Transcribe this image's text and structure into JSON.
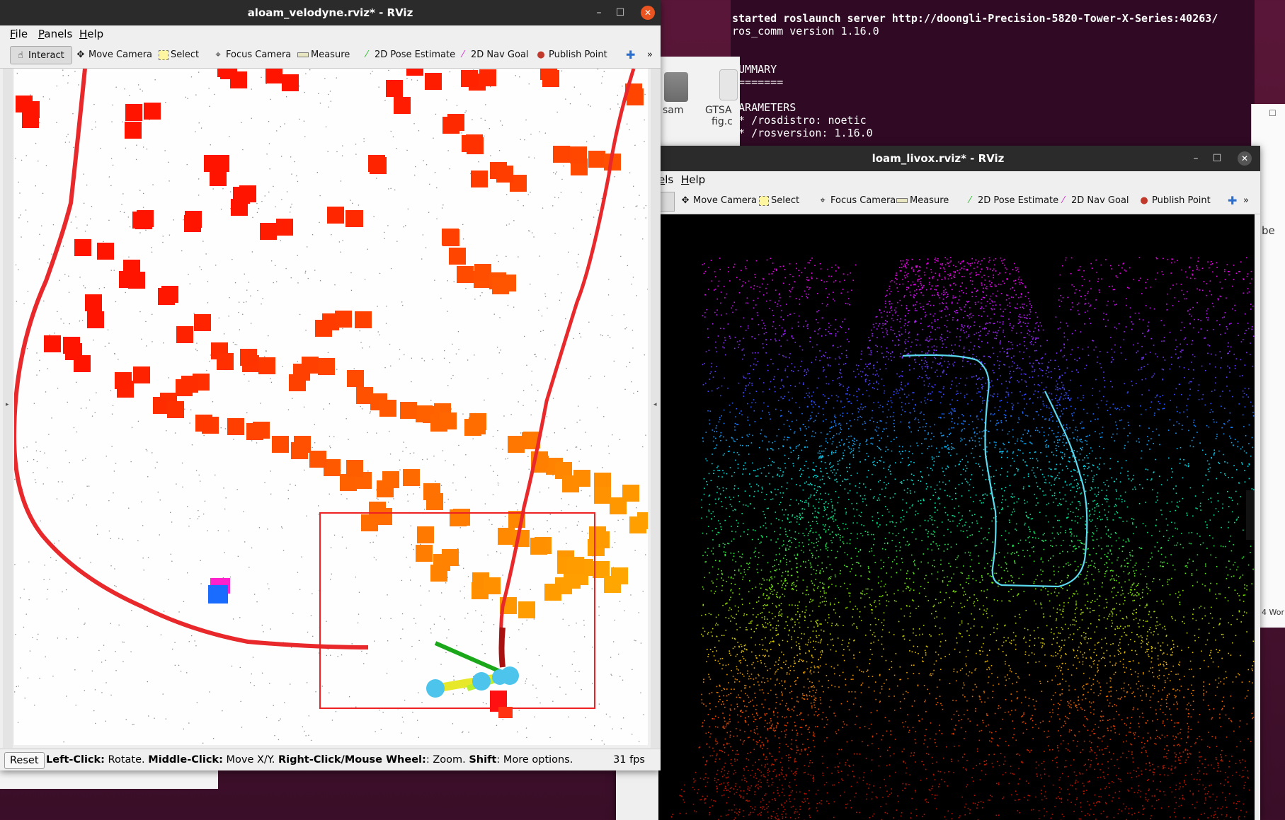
{
  "terminal": {
    "lines": [
      "started roslaunch server http://doongli-Precision-5820-Tower-X-Series:40263/",
      "ros_comm version 1.16.0",
      "",
      "",
      "SUMMARY",
      "========",
      "",
      "PARAMETERS",
      " * /rosdistro: noetic",
      " * /rosversion: 1.16.0"
    ]
  },
  "file_manager": {
    "item1_label": "sam",
    "item2_label_line1": "GTSA",
    "item2_label_line2": "fig.c"
  },
  "background_window": {
    "text1": "be",
    "text2": "4 Wor"
  },
  "left_window": {
    "title": "aloam_velodyne.rviz* - RViz",
    "menu": [
      "File",
      "Panels",
      "Help"
    ],
    "toolbar": [
      {
        "label": "Interact",
        "icon": "hand-icon"
      },
      {
        "label": "Move Camera",
        "icon": "move-camera-icon"
      },
      {
        "label": "Select",
        "icon": "select-icon"
      },
      {
        "label": "Focus Camera",
        "icon": "focus-camera-icon"
      },
      {
        "label": "Measure",
        "icon": "measure-icon"
      },
      {
        "label": "2D Pose Estimate",
        "icon": "pose-estimate-icon"
      },
      {
        "label": "2D Nav Goal",
        "icon": "nav-goal-icon"
      },
      {
        "label": "Publish Point",
        "icon": "publish-point-icon"
      }
    ],
    "active_tool": "Interact",
    "status": {
      "reset": "Reset",
      "hint_parts": [
        {
          "text": "Left-Click:",
          "bold": true
        },
        {
          "text": " Rotate. ",
          "bold": false
        },
        {
          "text": "Middle-Click:",
          "bold": true
        },
        {
          "text": " Move X/Y. ",
          "bold": false
        },
        {
          "text": "Right-Click/Mouse Wheel:",
          "bold": true
        },
        {
          "text": ": Zoom. ",
          "bold": false
        },
        {
          "text": "Shift",
          "bold": true
        },
        {
          "text": ": More options.",
          "bold": false
        }
      ],
      "fps": "31 fps"
    }
  },
  "right_window": {
    "title": "loam_livox.rviz* - RViz",
    "menu": [
      "els",
      "Help"
    ],
    "toolbar": [
      {
        "label": "Move Camera",
        "icon": "move-camera-icon"
      },
      {
        "label": "Select",
        "icon": "select-icon"
      },
      {
        "label": "Focus Camera",
        "icon": "focus-camera-icon"
      },
      {
        "label": "Measure",
        "icon": "measure-icon"
      },
      {
        "label": "2D Pose Estimate",
        "icon": "pose-estimate-icon"
      },
      {
        "label": "2D Nav Goal",
        "icon": "nav-goal-icon"
      },
      {
        "label": "Publish Point",
        "icon": "publish-point-icon"
      }
    ]
  },
  "colors": {
    "terminal_bg": "#300a24",
    "titlebar": "#2b2b2b",
    "close_button": "#e95420",
    "trajectory_red": "#e8282a",
    "trajectory_cyan": "#5ad8ee"
  }
}
